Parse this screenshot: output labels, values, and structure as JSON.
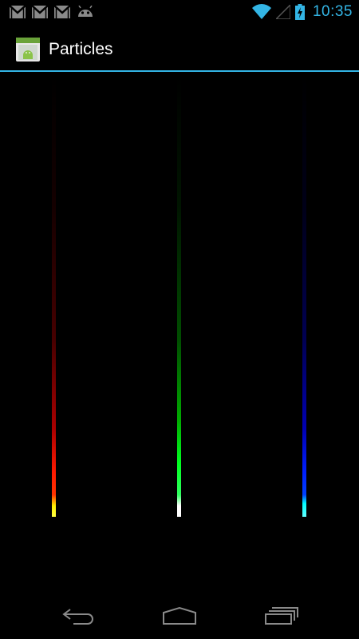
{
  "status_bar": {
    "time": "10:35",
    "clock_color": "#33b5e5",
    "left_icons": [
      "gmail-icon",
      "gmail-icon",
      "gmail-icon",
      "android-debug-icon"
    ],
    "right_icons": [
      "wifi-icon",
      "signal-icon",
      "battery-charging-icon"
    ]
  },
  "action_bar": {
    "title": "Particles",
    "icon": "android-app-icon",
    "divider_color": "#33b5e5"
  },
  "particles": {
    "streaks": [
      {
        "name": "red-streak",
        "color": "#ff1a00",
        "head_color": "#ffff40"
      },
      {
        "name": "green-streak",
        "color": "#00ff20",
        "head_color": "#ffffff"
      },
      {
        "name": "blue-streak",
        "color": "#0020ff",
        "head_color": "#60ffff"
      }
    ]
  },
  "nav_bar": {
    "buttons": [
      "back-icon",
      "home-icon",
      "recent-apps-icon"
    ]
  }
}
